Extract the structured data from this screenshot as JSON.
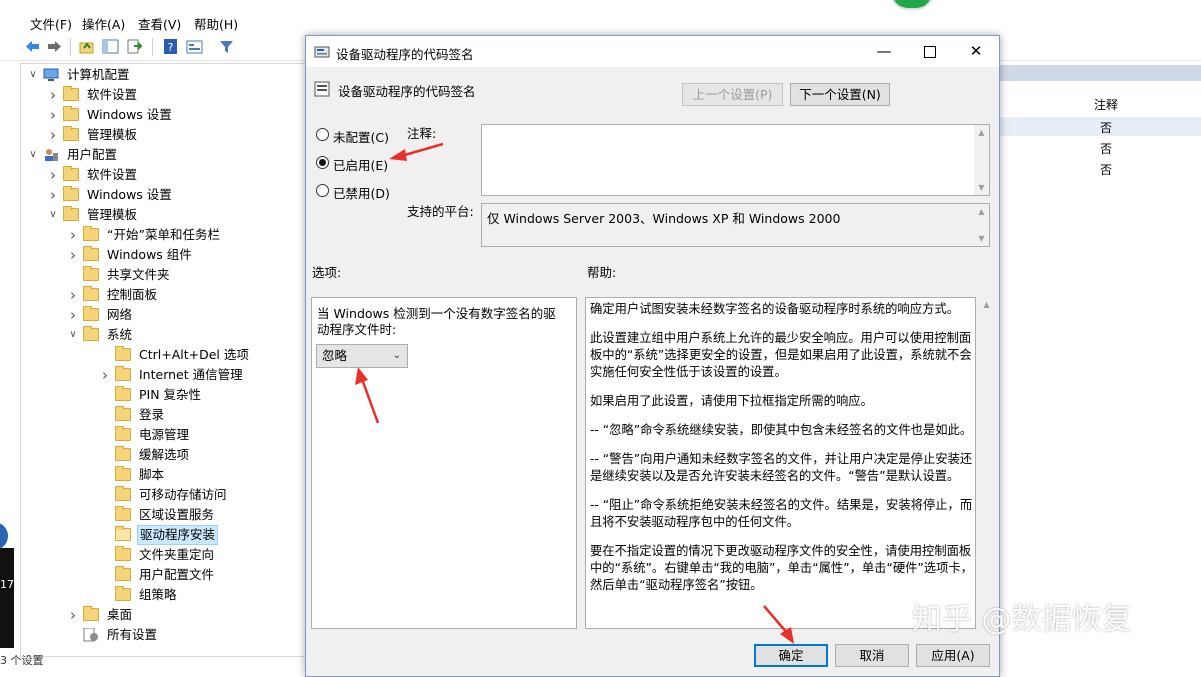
{
  "main": {
    "menu": [
      "文件(F)",
      "操作(A)",
      "查看(V)",
      "帮助(H)"
    ],
    "status": "3 个设置",
    "list_header": "注释",
    "list_values": [
      "否",
      "否",
      "否"
    ],
    "side_label": "17"
  },
  "tree": {
    "nodes": [
      {
        "label": "计算机配置",
        "level": 0,
        "chev": "v",
        "icon": "computer"
      },
      {
        "label": "软件设置",
        "level": 1,
        "chev": ">",
        "icon": "folder"
      },
      {
        "label": "Windows 设置",
        "level": 1,
        "chev": ">",
        "icon": "folder"
      },
      {
        "label": "管理模板",
        "level": 1,
        "chev": ">",
        "icon": "folder"
      },
      {
        "label": "用户配置",
        "level": 0,
        "chev": "v",
        "icon": "user"
      },
      {
        "label": "软件设置",
        "level": 1,
        "chev": ">",
        "icon": "folder"
      },
      {
        "label": "Windows 设置",
        "level": 1,
        "chev": ">",
        "icon": "folder"
      },
      {
        "label": "管理模板",
        "level": 1,
        "chev": "v",
        "icon": "folder"
      },
      {
        "label": "“开始”菜单和任务栏",
        "level": 2,
        "chev": ">",
        "icon": "folder"
      },
      {
        "label": "Windows 组件",
        "level": 2,
        "chev": ">",
        "icon": "folder"
      },
      {
        "label": "共享文件夹",
        "level": 2,
        "chev": "",
        "icon": "folder"
      },
      {
        "label": "控制面板",
        "level": 2,
        "chev": ">",
        "icon": "folder"
      },
      {
        "label": "网络",
        "level": 2,
        "chev": ">",
        "icon": "folder"
      },
      {
        "label": "系统",
        "level": 2,
        "chev": "v",
        "icon": "folder"
      },
      {
        "label": "Ctrl+Alt+Del 选项",
        "level": 3,
        "chev": "",
        "icon": "folder"
      },
      {
        "label": "Internet 通信管理",
        "level": 3,
        "chev": ">",
        "icon": "folder"
      },
      {
        "label": "PIN 复杂性",
        "level": 3,
        "chev": "",
        "icon": "folder"
      },
      {
        "label": "登录",
        "level": 3,
        "chev": "",
        "icon": "folder"
      },
      {
        "label": "电源管理",
        "level": 3,
        "chev": "",
        "icon": "folder"
      },
      {
        "label": "缓解选项",
        "level": 3,
        "chev": "",
        "icon": "folder"
      },
      {
        "label": "脚本",
        "level": 3,
        "chev": "",
        "icon": "folder"
      },
      {
        "label": "可移动存储访问",
        "level": 3,
        "chev": "",
        "icon": "folder"
      },
      {
        "label": "区域设置服务",
        "level": 3,
        "chev": "",
        "icon": "folder"
      },
      {
        "label": "驱动程序安装",
        "level": 3,
        "chev": "",
        "icon": "folder-open",
        "selected": true
      },
      {
        "label": "文件夹重定向",
        "level": 3,
        "chev": "",
        "icon": "folder"
      },
      {
        "label": "用户配置文件",
        "level": 3,
        "chev": "",
        "icon": "folder"
      },
      {
        "label": "组策略",
        "level": 3,
        "chev": "",
        "icon": "folder"
      },
      {
        "label": "桌面",
        "level": 2,
        "chev": ">",
        "icon": "folder"
      },
      {
        "label": "所有设置",
        "level": 2,
        "chev": "",
        "icon": "settings"
      }
    ]
  },
  "dialog": {
    "title": "设备驱动程序的代码签名",
    "header": "设备驱动程序的代码签名",
    "prev_button": "上一个设置(P)",
    "next_button": "下一个设置(N)",
    "radio_not_configured": "未配置(C)",
    "radio_enabled": "已启用(E)",
    "radio_disabled": "已禁用(D)",
    "comment_label": "注释:",
    "comment_value": "",
    "platform_label": "支持的平台:",
    "platform_value": "仅 Windows Server 2003、Windows XP 和 Windows 2000",
    "options_label": "选项:",
    "help_label": "帮助:",
    "option_text": "当 Windows 检测到一个没有数字签名的驱动程序文件时:",
    "option_selected": "忽略",
    "help_paragraphs": [
      "确定用户试图安装未经数字签名的设备驱动程序时系统的响应方式。",
      "此设置建立组中用户系统上允许的最少安全响应。用户可以使用控制面板中的“系统”选择更安全的设置，但是如果启用了此设置，系统就不会实施任何安全性低于该设置的设置。",
      "如果启用了此设置，请使用下拉框指定所需的响应。",
      "-- “忽略”命令系统继续安装，即使其中包含未经签名的文件也是如此。",
      "-- “警告”向用户通知未经数字签名的文件，并让用户决定是停止安装还是继续安装以及是否允许安装未经签名的文件。“警告”是默认设置。",
      "-- “阻止”命令系统拒绝安装未经签名的文件。结果是，安装将停止，而且将不安装驱动程序包中的任何文件。",
      "要在不指定设置的情况下更改驱动程序文件的安全性，请使用控制面板中的“系统”。右键单击“我的电脑”，单击“属性”，单击“硬件”选项卡，然后单击“驱动程序签名”按钮。"
    ],
    "ok_button": "确定",
    "cancel_button": "取消",
    "apply_button": "应用(A)"
  },
  "watermark": "知乎 @数据恢复",
  "colors": {
    "accent": "#0078d7",
    "selection": "#cce8ff",
    "annotation_arrow": "#e8302a",
    "folder": "#f3d478"
  }
}
